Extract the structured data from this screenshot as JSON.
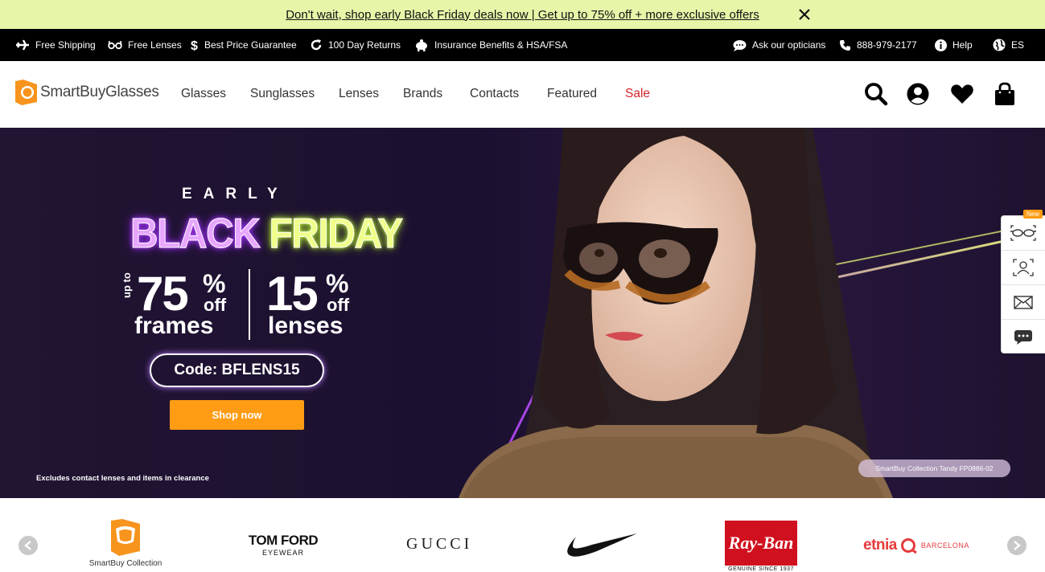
{
  "promo": {
    "text": "Don't wait, shop early Black Friday deals now | Get up to 75% off + more exclusive offers"
  },
  "usp_bar": {
    "items": [
      {
        "label": "Free Shipping",
        "icon": "plane-icon"
      },
      {
        "label": "Free Lenses",
        "icon": "glasses-icon"
      },
      {
        "label": "Best Price Guarantee",
        "icon": "dollar-icon"
      },
      {
        "label": "100 Day Returns",
        "icon": "return-icon"
      },
      {
        "label": "Insurance Benefits & HSA/FSA",
        "icon": "piggy-bank-icon"
      }
    ],
    "right": [
      {
        "label": "Ask our opticians",
        "icon": "chat-icon"
      },
      {
        "label": "888-979-2177",
        "icon": "phone-icon"
      },
      {
        "label": "Help",
        "icon": "info-icon"
      },
      {
        "label": "ES",
        "icon": "globe-icon"
      }
    ]
  },
  "header": {
    "logo_text": "SmartBuyGlasses",
    "nav": [
      "Glasses",
      "Sunglasses",
      "Lenses",
      "Brands",
      "Contacts",
      "Featured",
      "Sale"
    ]
  },
  "hero": {
    "early": "EARLY",
    "black": "BLACK",
    "friday": "FRIDAY",
    "up_to": "up to",
    "frames_pct": "75",
    "frames_off": "off",
    "frames_label": "frames",
    "lenses_pct": "15",
    "lenses_off": "off",
    "lenses_label": "lenses",
    "percent": "%",
    "code": "Code: BFLENS15",
    "cta": "Shop now",
    "disclaimer": "Excludes contact lenses and items in clearance",
    "product_tag": "SmartBuy Collection Tandy FP0886-02"
  },
  "side_tools": {
    "new_badge": "New"
  },
  "brands": {
    "items": [
      "SmartBuy Collection",
      "TOM FORD",
      "EYEWEAR",
      "GUCCI",
      "Ray-Ban",
      "GENUINE SINCE 1937",
      "etnia",
      "BARCELONA"
    ]
  },
  "colors": {
    "promo_bg": "#e6f5a8",
    "accent_orange": "#ff9c14",
    "sale_red": "#d0252c"
  }
}
